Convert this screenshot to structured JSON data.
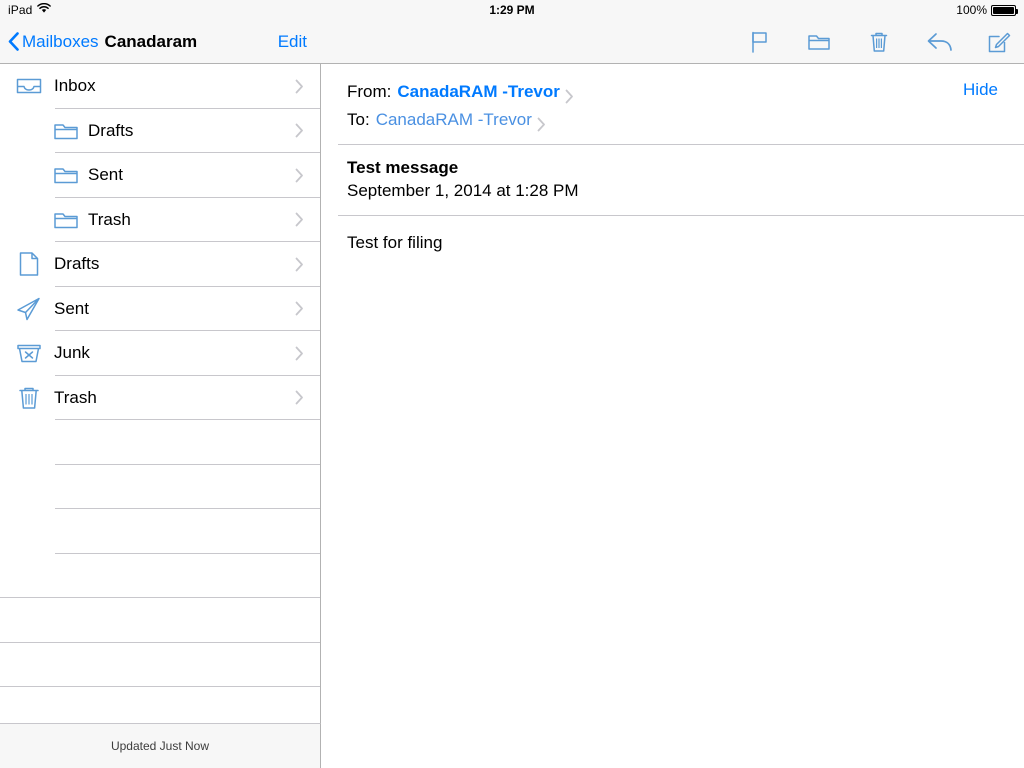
{
  "statusbar": {
    "carrier": "iPad",
    "wifi_icon": "wifi-icon",
    "time": "1:29 PM",
    "battery_percent": "100%",
    "battery_icon": "battery-full-icon"
  },
  "sidebar": {
    "back_label": "Mailboxes",
    "back_icon": "chevron-left-icon",
    "title": "Canadaram",
    "edit_label": "Edit",
    "items": [
      {
        "label": "Inbox",
        "icon": "inbox-tray-icon",
        "level": 1,
        "disclosure": "chevron-right-icon",
        "separator": "inset"
      },
      {
        "label": "Drafts",
        "icon": "folder-icon",
        "level": 2,
        "disclosure": "chevron-right-icon",
        "separator": "inset"
      },
      {
        "label": "Sent",
        "icon": "folder-icon",
        "level": 2,
        "disclosure": "chevron-right-icon",
        "separator": "inset"
      },
      {
        "label": "Trash",
        "icon": "folder-icon",
        "level": 2,
        "disclosure": "chevron-right-icon",
        "separator": "inset"
      },
      {
        "label": "Drafts",
        "icon": "document-icon",
        "level": 1,
        "disclosure": "chevron-right-icon",
        "separator": "inset"
      },
      {
        "label": "Sent",
        "icon": "paper-plane-icon",
        "level": 1,
        "disclosure": "chevron-right-icon",
        "separator": "inset"
      },
      {
        "label": "Junk",
        "icon": "junk-bin-icon",
        "level": 1,
        "disclosure": "chevron-right-icon",
        "separator": "inset"
      },
      {
        "label": "Trash",
        "icon": "trash-can-icon",
        "level": 1,
        "disclosure": "chevron-right-icon",
        "separator": "inset"
      }
    ],
    "empty_rows": [
      {
        "separator": "inset"
      },
      {
        "separator": "inset"
      },
      {
        "separator": "inset"
      },
      {
        "separator": "full"
      },
      {
        "separator": "full"
      },
      {
        "separator": "full"
      },
      {
        "separator": "none"
      }
    ],
    "footer_text": "Updated Just Now"
  },
  "toolbar": {
    "icons": [
      {
        "name": "flag-icon"
      },
      {
        "name": "folder-move-icon"
      },
      {
        "name": "trash-icon"
      },
      {
        "name": "reply-icon"
      },
      {
        "name": "compose-icon"
      }
    ]
  },
  "message": {
    "from_label": "From:",
    "from_name": "CanadaRAM -Trevor",
    "to_label": "To:",
    "to_name": "CanadaRAM -Trevor",
    "detail_chevron": "chevron-right-icon",
    "hide_label": "Hide",
    "subject": "Test message",
    "date": "September 1, 2014 at 1:28 PM",
    "body": "Test for filing"
  },
  "colors": {
    "accent_blue": "#007aff",
    "secondary_blue": "#4a90e2",
    "icon_blue": "#5b9bd5",
    "bar_background": "#f7f7f7",
    "separator": "#c8c7cc"
  }
}
